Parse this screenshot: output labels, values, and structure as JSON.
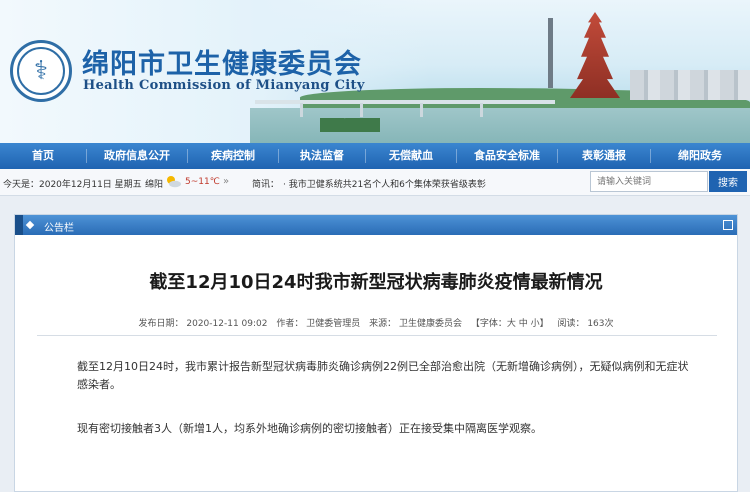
{
  "site": {
    "name_cn": "绵阳市卫生健康委员会",
    "name_en": "Health Commission of Mianyang City",
    "logo_icon": "caduceus-emblem-icon"
  },
  "nav": {
    "items": [
      {
        "label": "首页"
      },
      {
        "label": "政府信息公开"
      },
      {
        "label": "疾病控制"
      },
      {
        "label": "执法监督"
      },
      {
        "label": "无偿献血"
      },
      {
        "label": "食品安全标准"
      },
      {
        "label": "表彰通报"
      },
      {
        "label": "绵阳政务"
      }
    ],
    "color": "#1f63b1"
  },
  "infobar": {
    "date": "今天是：2020年12月11日 星期五",
    "city": "绵阳",
    "weather_icon": "partly-sunny-icon",
    "temp": "5~11℃",
    "news_label": "简讯：",
    "news": "· 我市卫健系统共21名个人和6个集体荣获省级表彰"
  },
  "search": {
    "placeholder": "请输入关键词",
    "button": "搜索"
  },
  "panel": {
    "heading": "公告栏"
  },
  "article": {
    "title": "截至12月10日24时我市新型冠状病毒肺炎疫情最新情况",
    "meta": {
      "published": "发布日期： 2020-12-11 09:02",
      "author": "作者： 卫健委管理员",
      "source": "来源： 卫生健康委员会",
      "font": "【字体：大 中 小】",
      "views": "阅读： 163次"
    },
    "paragraphs": [
      "截至12月10日24时，我市累计报告新型冠状病毒肺炎确诊病例22例已全部治愈出院（无新增确诊病例），无疑似病例和无症状感染者。",
      "现有密切接触者3人（新增1人，均系外地确诊病例的密切接触者）正在接受集中隔离医学观察。"
    ]
  }
}
